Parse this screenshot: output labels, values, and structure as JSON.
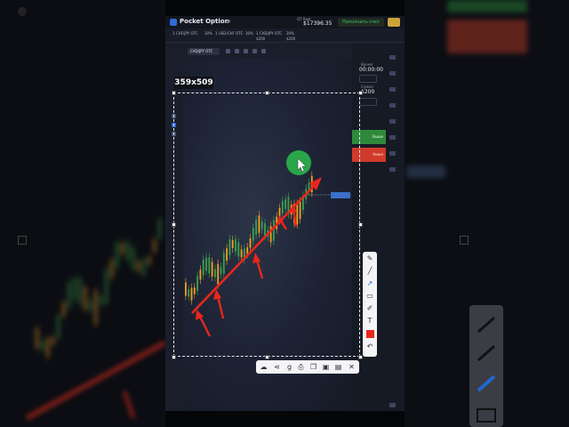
{
  "app": {
    "name": "Pocket Option",
    "account_label": "QT Real",
    "balance": "$17396.35",
    "deposit_label": "Пополнить счет"
  },
  "trade_tabs": [
    {
      "label": "1 CHF/JPY OTC"
    },
    {
      "label": "30%"
    },
    {
      "label": "1 USD/CHF OTC"
    },
    {
      "label": "30%"
    },
    {
      "label": "1 CAD/JPY OTC"
    },
    {
      "label": "$200"
    },
    {
      "label": "30%"
    },
    {
      "label": "$200"
    }
  ],
  "chart": {
    "pair": "CAD/JPY OTC"
  },
  "side_panel": {
    "time_label": "Время",
    "time_value": "00:00:00",
    "amount_label": "Сумма",
    "amount_value": "$200",
    "higher_label": "Выше",
    "lower_label": "Ниже"
  },
  "screenshot_tool": {
    "dimensions": "359x509",
    "price_tag": "108.777"
  },
  "colors": {
    "higher": "#2e8a3a",
    "lower": "#d03a2a",
    "annotation": "#e8261c",
    "candle_up": "#f0a020",
    "candle_down": "#3aa050"
  }
}
